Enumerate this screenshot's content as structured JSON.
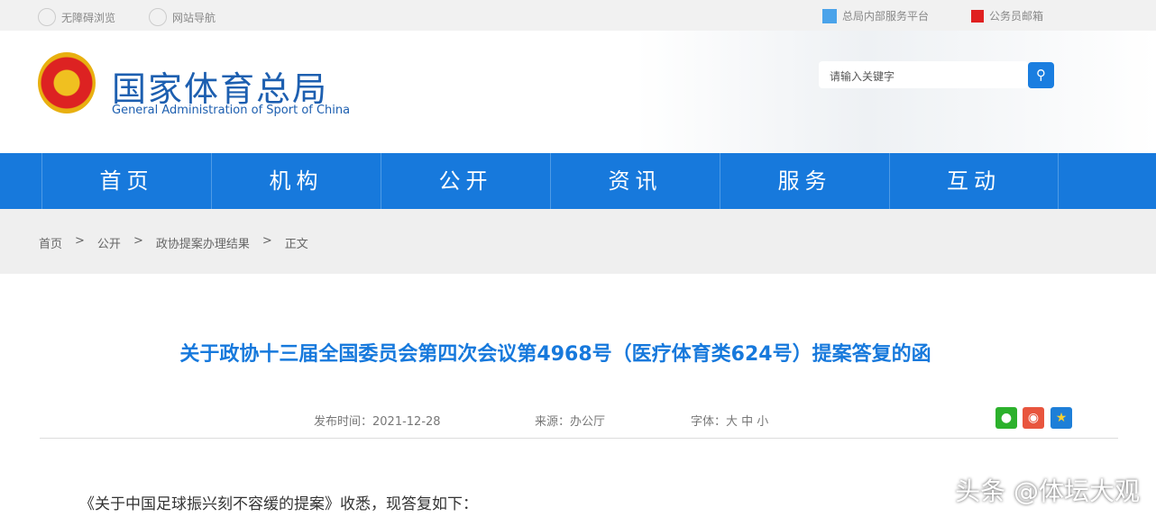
{
  "topbar": {
    "accessibility": "无障碍浏览",
    "sitemap": "网站导航",
    "internal": "总局内部服务平台",
    "mail": "公务员邮箱"
  },
  "header": {
    "title_cn": "国家体育总局",
    "title_en": "General Administration of Sport of China",
    "search_placeholder": "请输入关键字"
  },
  "nav": [
    "首页",
    "机构",
    "公开",
    "资讯",
    "服务",
    "互动"
  ],
  "breadcrumb": [
    "首页",
    ">",
    "公开",
    ">",
    "政协提案办理结果",
    ">",
    "正文"
  ],
  "article": {
    "title": "关于政协十三届全国委员会第四次会议第4968号（医疗体育类624号）提案答复的函",
    "date": "发布时间：2021-12-28",
    "source": "来源：办公厅",
    "font": "字体：大 中 小",
    "body": "《关于中国足球振兴刻不容缓的提案》收悉，现答复如下："
  },
  "watermark": "头条 @体坛大观"
}
